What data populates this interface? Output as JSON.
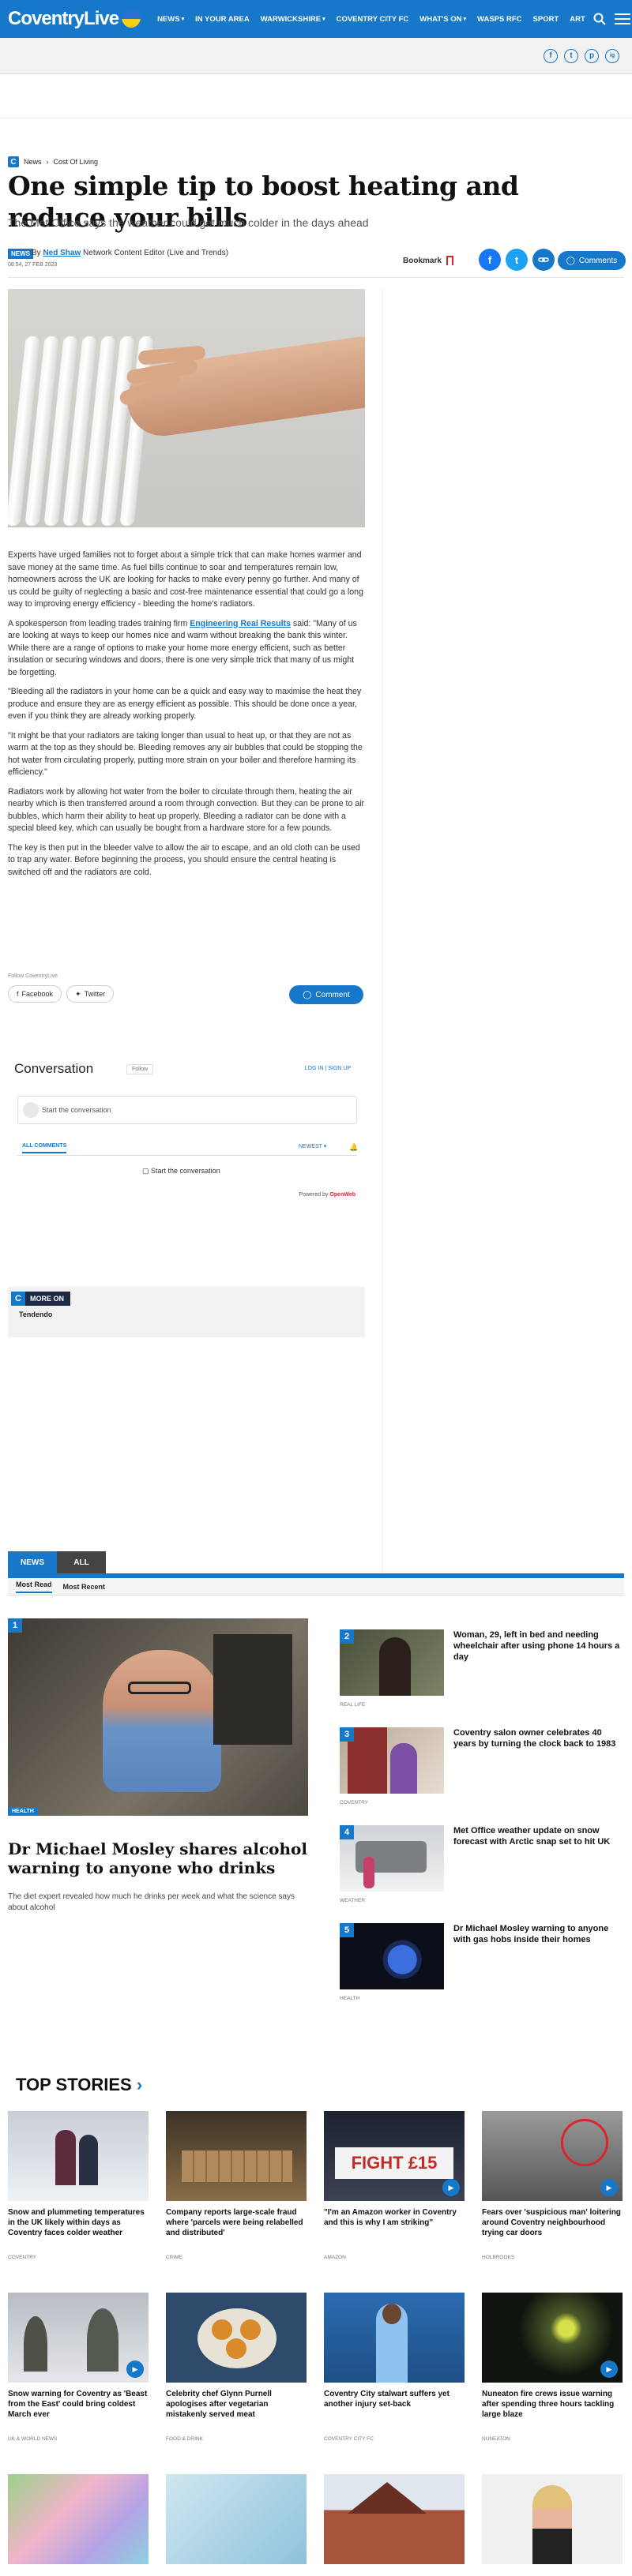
{
  "header": {
    "logo_text": "CoventryLive",
    "nav": [
      "NEWS",
      "IN YOUR AREA",
      "WARWICKSHIRE",
      "COVENTRY CITY FC",
      "WHAT'S ON",
      "WASPS RFC",
      "SPORT",
      "ART"
    ],
    "nav_dropdowns": [
      "NEWS",
      "WARWICKSHIRE",
      "WHAT'S ON"
    ]
  },
  "social_top": [
    "f",
    "t",
    "p",
    "ig"
  ],
  "breadcrumb": {
    "badge": "C",
    "items": [
      "News",
      "Cost Of Living"
    ]
  },
  "article": {
    "headline": "One simple tip to boost heating and reduce your bills",
    "standfirst": "The Met Office says the weather could get much colder in the days ahead",
    "badge": "NEWS",
    "by": "By",
    "author": "Ned Shaw",
    "author_role": "Network Content Editor (Live and Trends)",
    "date": "08:54, 27 FEB 2023",
    "bookmark": "Bookmark",
    "comments_label": "Comments",
    "paragraphs": [
      "Experts have urged families not to forget about a simple trick that can make homes warmer and save money at the same time. As fuel bills continue to soar and temperatures remain low, homeowners across the UK are looking for hacks to make every penny go further. And many of us could be guilty of neglecting a basic and cost-free maintenance essential that could go a long way to improving energy efficiency - bleeding the home's radiators.",
      "\"Bleeding all the radiators in your home can be a quick and easy way to maximise the heat they produce and ensure they are as energy efficient as possible. This should be done once a year, even if you think they are already working properly.",
      "\"It might be that your radiators are taking longer than usual to heat up, or that they are not as warm at the top as they should be. Bleeding removes any air bubbles that could be stopping the hot water from circulating properly, putting more strain on your boiler and therefore harming its efficiency.\"",
      "Radiators work by allowing hot water from the boiler to circulate through them, heating the air nearby which is then transferred around a room through convection. But they can be prone to air bubbles, which harm their ability to heat up properly. Bleeding a radiator can be done with a special bleed key, which can usually be bought from a hardware store for a few pounds.",
      "The key is then put in the bleeder valve to allow the air to escape, and an old cloth can be used to trap any water. Before beginning the process, you should ensure the central heating is switched off and the radiators are cold."
    ],
    "para2_before": "A spokesperson from leading trades training firm ",
    "para2_link": "Engineering Real Results",
    "para2_after": " said: \"Many of us are looking at ways to keep our homes nice and warm without breaking the bank this winter. While there are a range of options to make your home more energy efficient, such as better insulation or securing windows and doors, there is one very simple trick that many of us might be forgetting.",
    "follow": "Follow CoventryLive",
    "share_facebook": "Facebook",
    "share_twitter": "Twitter",
    "comment_btn": "Comment"
  },
  "conversation": {
    "title": "Conversation",
    "status": "Follow",
    "login": "LOG IN | SIGN UP",
    "placeholder": "Start the conversation",
    "tab": "ALL COMMENTS",
    "sort": "NEWEST",
    "start_text": "Start the conversation",
    "powered_by": "Powered by",
    "brand": "OpenWeb"
  },
  "more_on": {
    "label": "MORE ON",
    "topic": "Tendendo"
  },
  "news_tabs": [
    "NEWS",
    "ALL"
  ],
  "news_subtabs": [
    "Most Read",
    "Most Recent"
  ],
  "featured": {
    "num": "1",
    "tag": "HEALTH",
    "title": "Dr Michael Mosley shares alcohol warning to anyone who drinks",
    "summary": "The diet expert revealed how much he drinks per week and what the science says about alcohol"
  },
  "most_read": [
    {
      "num": "2",
      "title": "Woman, 29, left in bed and needing wheelchair after using phone 14 hours a day",
      "cat": "REAL LIFE"
    },
    {
      "num": "3",
      "title": "Coventry salon owner celebrates 40 years by turning the clock back to 1983",
      "cat": "COVENTRY"
    },
    {
      "num": "4",
      "title": "Met Office weather update on snow forecast with Arctic snap set to hit UK",
      "cat": "WEATHER"
    },
    {
      "num": "5",
      "title": "Dr Michael Mosley warning to anyone with gas hobs inside their homes",
      "cat": "HEALTH"
    }
  ],
  "top_stories_title": "TOP STORIES",
  "top_stories": [
    {
      "title": "Snow and plummeting temperatures in the UK likely within days as Coventry faces colder weather",
      "cat": "COVENTRY"
    },
    {
      "title": "Company reports large-scale fraud where 'parcels were being relabelled and distributed'",
      "cat": "CRIME"
    },
    {
      "title": "\"I'm an Amazon worker in Coventry and this is why I am striking\"",
      "cat": "AMAZON"
    },
    {
      "title": "Fears over 'suspicious man' loitering around Coventry neighbourhood trying car doors",
      "cat": "HOLBROOKS"
    },
    {
      "title": "Snow warning for Coventry as 'Beast from the East' could bring coldest March ever",
      "cat": "UK & WORLD NEWS"
    },
    {
      "title": "Celebrity chef Glynn Purnell apologises after vegetarian mistakenly served meat",
      "cat": "FOOD & DRINK"
    },
    {
      "title": "Coventry City stalwart suffers yet another injury set-back",
      "cat": "COVENTRY CITY FC"
    },
    {
      "title": "Nuneaton fire crews issue warning after spending three hours tackling large blaze",
      "cat": "NUNEATON"
    }
  ],
  "strike_sign": "FIGHT £15",
  "colors": {
    "brand": "#1777c8",
    "facebook": "#1877f2",
    "twitter": "#1da1f2",
    "accent_red": "#d9262b",
    "dark": "#1f2a44"
  }
}
